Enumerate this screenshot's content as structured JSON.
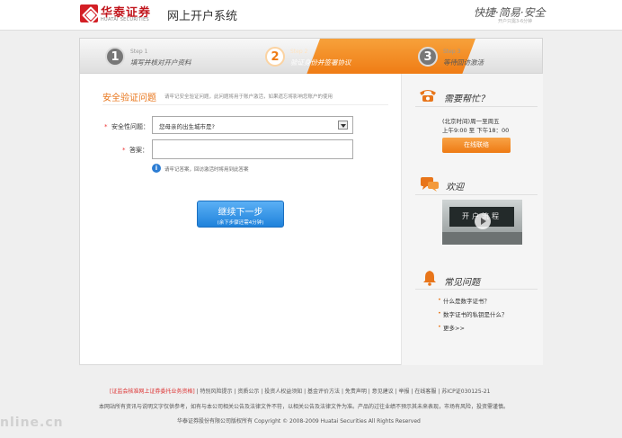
{
  "header": {
    "brand_cn": "华泰证券",
    "brand_en": "HUATAI SECURITIES",
    "system_title": "网上开户系统",
    "slogan": "快捷·简易·安全",
    "slogan_sub": "开户只需3-6分钟"
  },
  "steps": [
    {
      "num": "1",
      "label": "Step 1",
      "text": "填写并核对开户资料",
      "active": false
    },
    {
      "num": "2",
      "label": "Step 2",
      "text": "验证身份并签署协议",
      "active": true
    },
    {
      "num": "3",
      "label": "Step 3",
      "text": "等待回访激活",
      "active": false
    }
  ],
  "form": {
    "title": "安全验证问题",
    "note": "请牢记安全验证问题，此问题将用于账户激活，如果遗忘将影响您账户的使用",
    "question_label": "安全性问题：",
    "question_value": "您母亲的出生城市是?",
    "answer_label": "答案：",
    "hint": "请牢记答案，回访激活时将用到此答案",
    "next_label": "继续下一步",
    "next_sub": "(余下步骤还需4分钟)"
  },
  "side": {
    "help_title": "需要帮忙？",
    "help_hours": "(北京时间)周一至周五",
    "help_time": "上午9:00 至 下午18：00",
    "online_button": "在线联络",
    "welcome_title": "欢迎",
    "video_board": "开户流程",
    "faq_title": "常见问题",
    "faq_items": [
      "什么是数字证书？",
      "数字证书的私钥是什么？",
      "更多>>"
    ]
  },
  "footer": {
    "line1_red": "[证监会核准网上证券委托业务资格]",
    "line1_rest": " | 特别风险提示 | 资质公示 | 投资人权益须知 | 基金评价方法 | 免责声明 | 意见建议 | 举报 | 在线客服 | 苏ICP证030125-21",
    "line2": "本网站所有资讯与说明文字仅供参考，如有与本公司相关公告及法律文件不符，以相关公告及法律文件为准。产品的过往业绩不预示其未来表现，市场有风险，投资需谨慎。",
    "line3": "华泰证券股份有限公司版权所有     Copyright © 2008-2009 Huatai Securities All Rights Reserved",
    "watermark": "nline.cn"
  },
  "colors": {
    "accent_orange": "#ef7b14",
    "brand_red": "#c1151c",
    "button_blue": "#1f82db"
  }
}
